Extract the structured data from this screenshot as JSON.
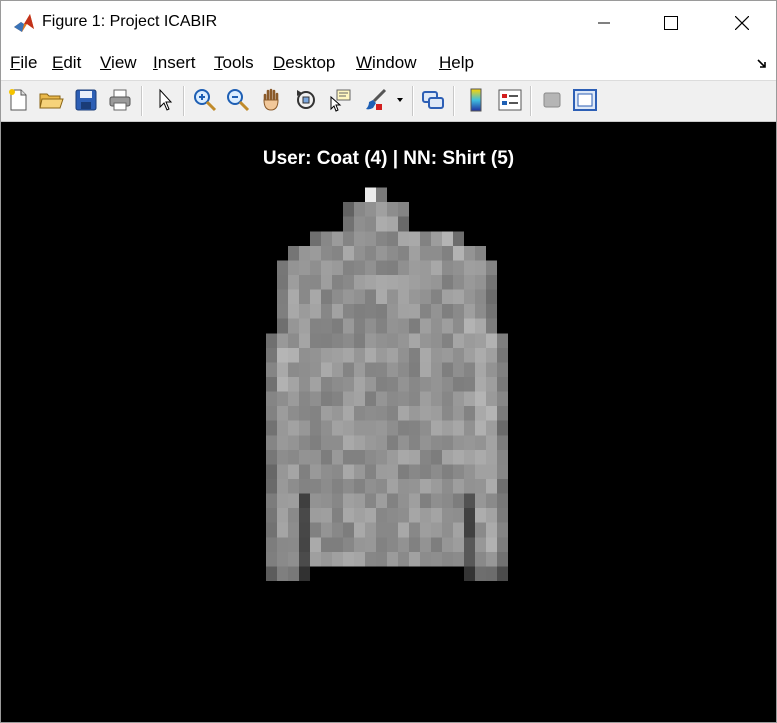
{
  "window": {
    "title": "Figure 1: Project ICABIR"
  },
  "menu": [
    "File",
    "Edit",
    "View",
    "Insert",
    "Tools",
    "Desktop",
    "Window",
    "Help"
  ],
  "toolbar": {
    "buttons": [
      "new-figure",
      "open-file",
      "save",
      "print",
      "edit-plot",
      "zoom-in",
      "zoom-out",
      "pan",
      "rotate-3d",
      "data-cursor",
      "brush",
      "link-plot",
      "insert-colorbar",
      "insert-legend",
      "hide-plot-tools",
      "show-plot-tools"
    ]
  },
  "axes": {
    "title": "User: Coat (4) | NN: Shirt (5)",
    "image": {
      "rows": 28,
      "cols": 28,
      "colormap": "gray",
      "background": "#000000",
      "description_shape": "coat"
    }
  },
  "colors": {
    "figure_background": "#000000",
    "toolbar_background": "#f0f0f0",
    "title_color": "#ffffff"
  }
}
